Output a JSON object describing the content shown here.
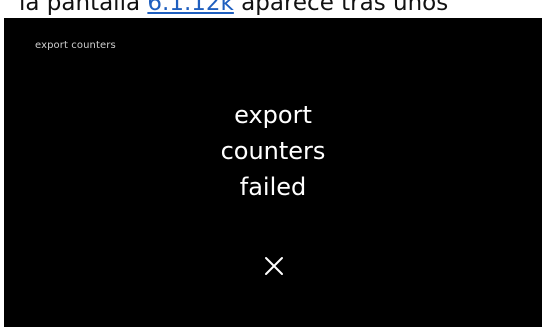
{
  "doc_caption": {
    "before": "la pantalla ",
    "link": "6.1.12k",
    "after": " aparece tras unos"
  },
  "screen": {
    "title": "export counters",
    "message_lines": [
      "export",
      "counters",
      "failed"
    ],
    "icon": "close-icon",
    "background": "#000000",
    "text_color": "#ffffff"
  }
}
